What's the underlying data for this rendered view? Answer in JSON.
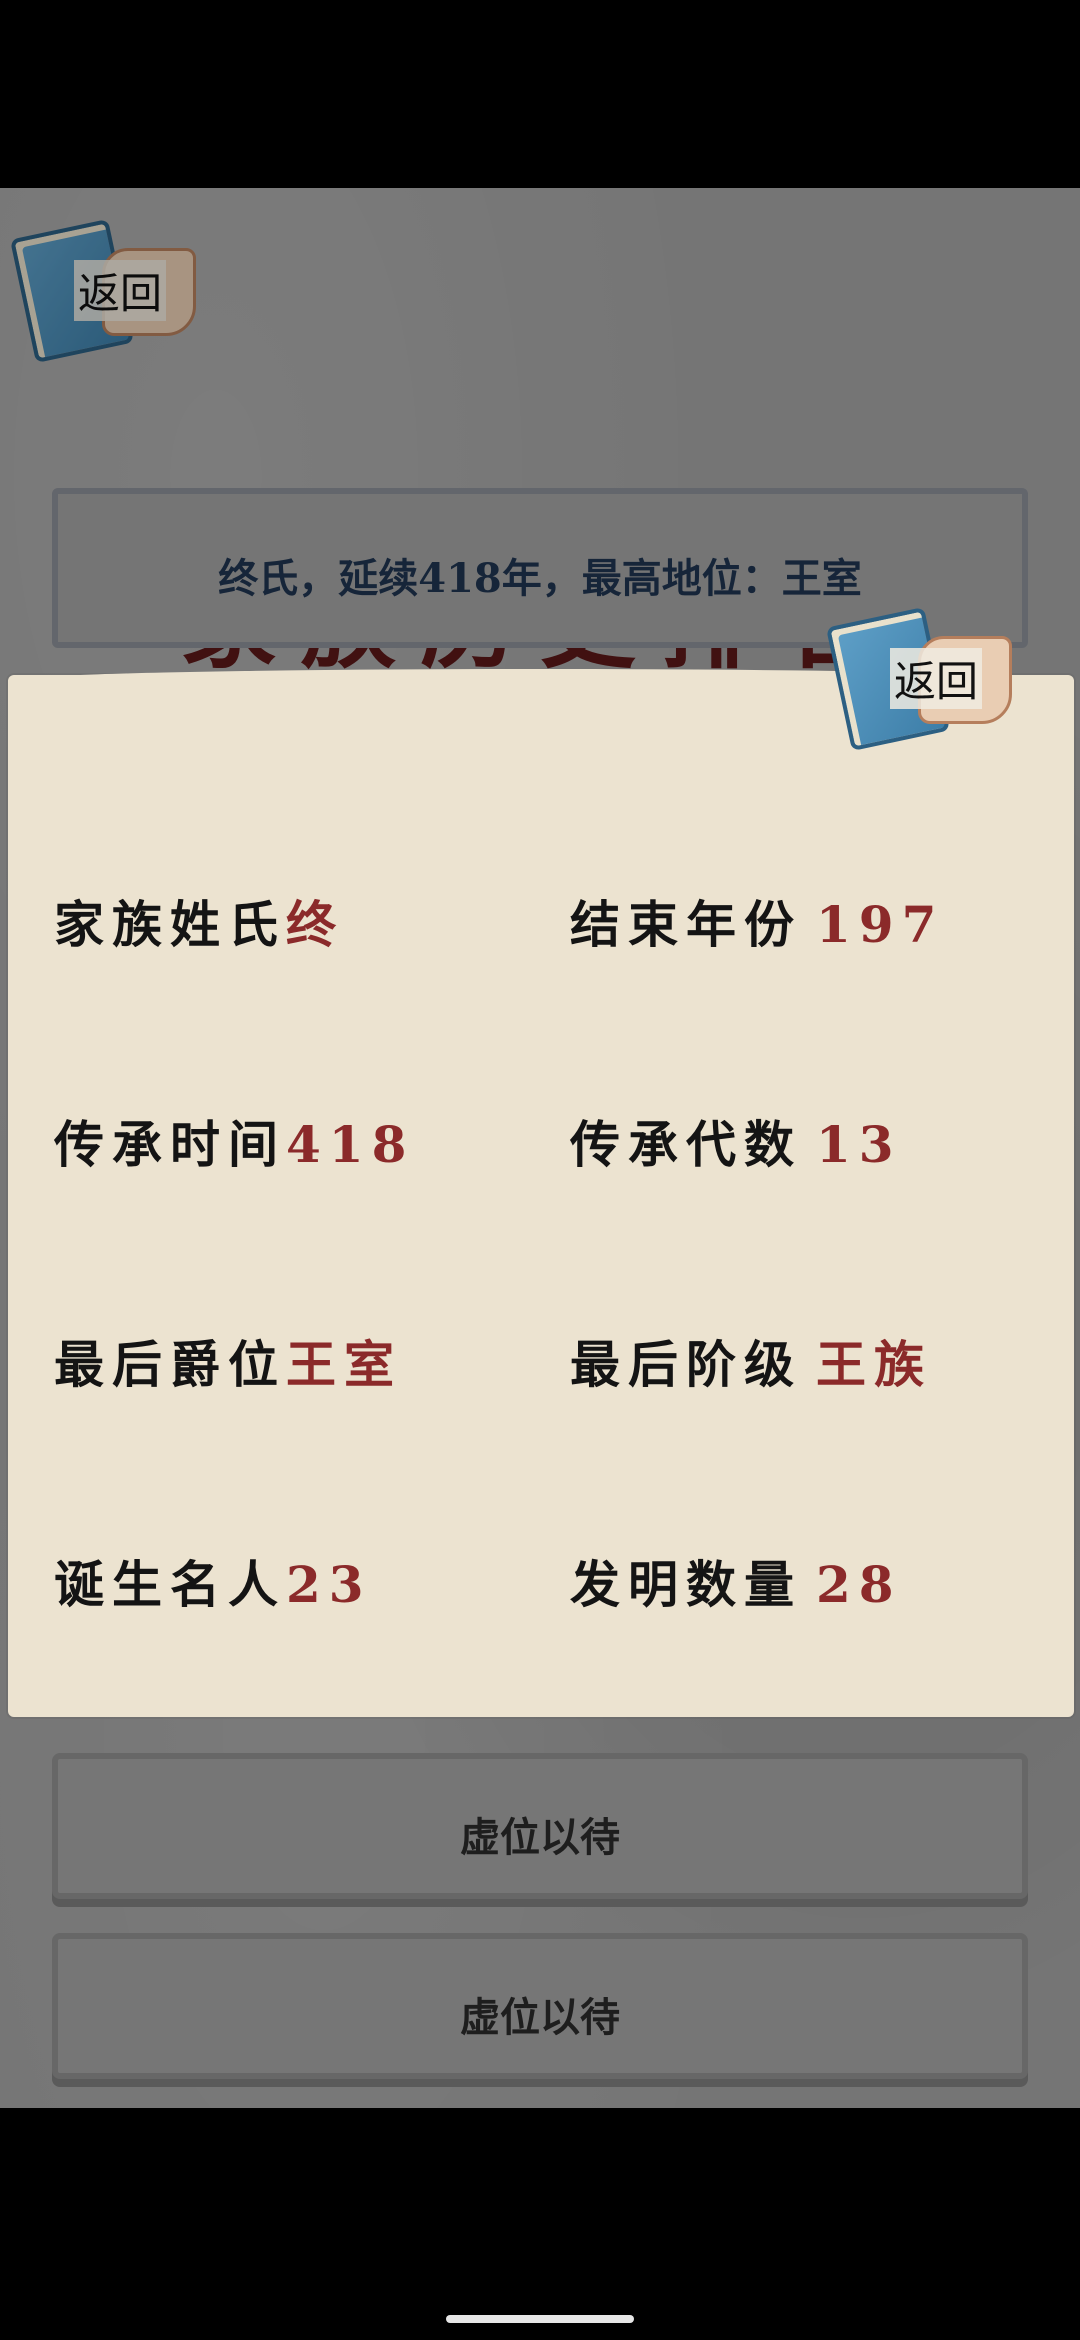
{
  "back_label": "返回",
  "title": "家族历史排名",
  "summary": "终氏，延续418年，最高地位：王室",
  "list": [
    {
      "label": "虚位以待"
    },
    {
      "label": "虚位以待"
    }
  ],
  "modal": {
    "back_label": "返回",
    "stats": [
      {
        "key": "家族姓氏",
        "value": "终"
      },
      {
        "key": "结束年份",
        "value": "197"
      },
      {
        "key": "传承时间",
        "value": "418"
      },
      {
        "key": "传承代数",
        "value": "13"
      },
      {
        "key": "最后爵位",
        "value": "王室"
      },
      {
        "key": "最后阶级",
        "value": "王族"
      },
      {
        "key": "诞生名人",
        "value": "23"
      },
      {
        "key": "发明数量",
        "value": "28"
      }
    ]
  },
  "colors": {
    "title": "#5a1818",
    "summary": "#1f3450",
    "value": "#8b2a2a",
    "parchment": "#ece3d0"
  },
  "icons": {
    "back": "book-scroll-icon"
  }
}
